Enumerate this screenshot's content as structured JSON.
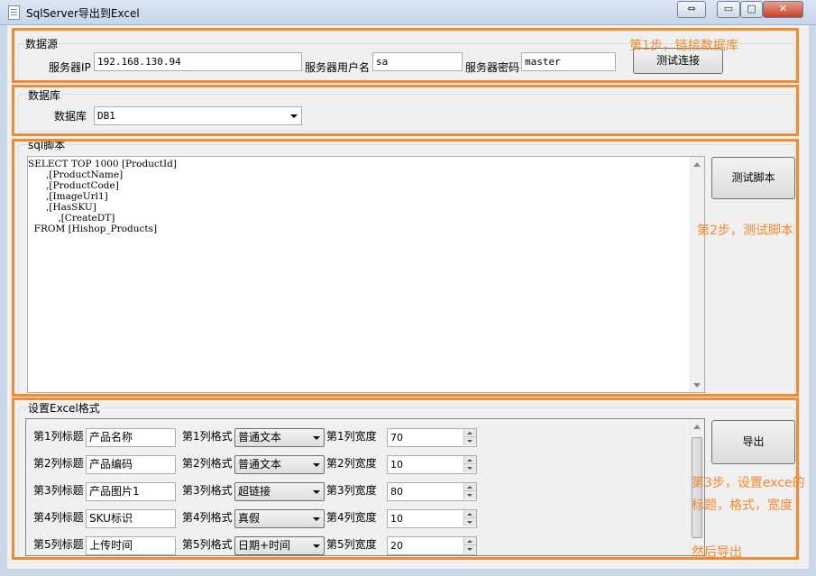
{
  "window": {
    "title": "SqlServer导出到Excel",
    "switch_glyph": "⇔",
    "min_glyph": "▭",
    "max_glyph": "□",
    "close_glyph": "✕"
  },
  "datasource": {
    "group_label": "数据源",
    "server_ip_label": "服务器IP",
    "server_ip_value": "192.168.130.94",
    "user_label": "服务器用户名",
    "user_value": "sa",
    "password_label": "服务器密码",
    "password_value": "master",
    "test_connection_button": "测试连接"
  },
  "database": {
    "group_label": "数据库",
    "db_label": "数据库",
    "db_value": "DB1"
  },
  "sql": {
    "group_label": "sql脚本",
    "script": "SELECT TOP 1000 [ProductId]\n      ,[ProductName]\n      ,[ProductCode]\n      ,[ImageUrl1]\n      ,[HasSKU]\n          ,[CreateDT]\n  FROM [Hishop_Products]",
    "test_script_button": "测试脚本"
  },
  "excel": {
    "group_label": "设置Excel格式",
    "export_button": "导出",
    "rows": [
      {
        "title_label": "第1列标题",
        "title_value": "产品名称",
        "format_label": "第1列格式",
        "format_value": "普通文本",
        "width_label": "第1列宽度",
        "width_value": "70"
      },
      {
        "title_label": "第2列标题",
        "title_value": "产品编码",
        "format_label": "第2列格式",
        "format_value": "普通文本",
        "width_label": "第2列宽度",
        "width_value": "10"
      },
      {
        "title_label": "第3列标题",
        "title_value": "产品图片1",
        "format_label": "第3列格式",
        "format_value": "超链接",
        "width_label": "第3列宽度",
        "width_value": "80"
      },
      {
        "title_label": "第4列标题",
        "title_value": "SKU标识",
        "format_label": "第4列格式",
        "format_value": "真假",
        "width_label": "第4列宽度",
        "width_value": "10"
      },
      {
        "title_label": "第5列标题",
        "title_value": "上传时间",
        "format_label": "第5列格式",
        "format_value": "日期+时间",
        "width_label": "第5列宽度",
        "width_value": "20"
      }
    ]
  },
  "annotations": {
    "step1": "第1步，链接数据库",
    "step2": "第2步，测试脚本",
    "step3_line1": "第3步，设置exce的",
    "step3_line2": "标题，格式，宽度",
    "step3_line3": "然后导出",
    "color": "#f28a2e"
  }
}
